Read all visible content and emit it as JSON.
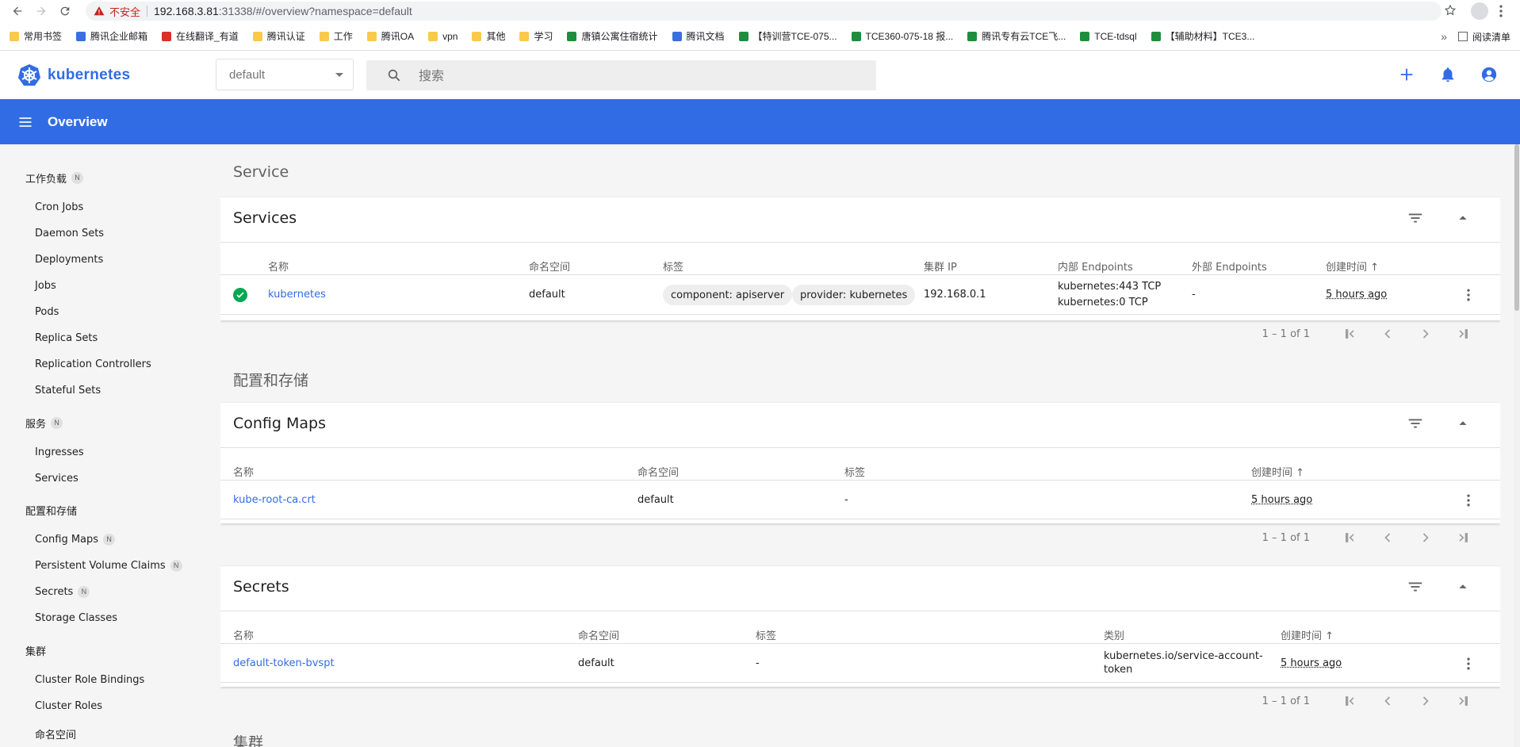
{
  "browser": {
    "insecure_label": "不安全",
    "url_host": "192.168.3.81",
    "url_rest": ":31338/#/overview?namespace=default",
    "bookmarks": [
      {
        "label": "常用书签",
        "kind": "folder"
      },
      {
        "label": "腾讯企业邮箱",
        "kind": "blue"
      },
      {
        "label": "在线翻译_有道",
        "kind": "red"
      },
      {
        "label": "腾讯认证",
        "kind": "folder"
      },
      {
        "label": "工作",
        "kind": "folder"
      },
      {
        "label": "腾讯OA",
        "kind": "folder"
      },
      {
        "label": "vpn",
        "kind": "folder"
      },
      {
        "label": "其他",
        "kind": "folder"
      },
      {
        "label": "学习",
        "kind": "folder"
      },
      {
        "label": "唐镇公寓住宿统计",
        "kind": "sheet"
      },
      {
        "label": "腾讯文档",
        "kind": "blue"
      },
      {
        "label": "【特训营TCE-075...",
        "kind": "sheet"
      },
      {
        "label": "TCE360-075-18 报...",
        "kind": "sheet"
      },
      {
        "label": "腾讯专有云TCE飞...",
        "kind": "sheet"
      },
      {
        "label": "TCE-tdsql",
        "kind": "sheet"
      },
      {
        "label": "【辅助材料】TCE3...",
        "kind": "sheet"
      }
    ],
    "overflow": "»",
    "reading_list": "阅读清单"
  },
  "header": {
    "logo_text": "kubernetes",
    "namespace": "default",
    "search_placeholder": "搜索"
  },
  "toolbar": {
    "title": "Overview"
  },
  "sidebar": {
    "workloads": {
      "label": "工作负载",
      "badge": "N",
      "items": [
        "Cron Jobs",
        "Daemon Sets",
        "Deployments",
        "Jobs",
        "Pods",
        "Replica Sets",
        "Replication Controllers",
        "Stateful Sets"
      ]
    },
    "services": {
      "label": "服务",
      "badge": "N",
      "items": [
        "Ingresses",
        "Services"
      ]
    },
    "config": {
      "label": "配置和存储",
      "items": [
        {
          "label": "Config Maps",
          "badge": "N"
        },
        {
          "label": "Persistent Volume Claims",
          "badge": "N"
        },
        {
          "label": "Secrets",
          "badge": "N"
        },
        {
          "label": "Storage Classes",
          "badge": ""
        }
      ]
    },
    "cluster": {
      "label": "集群",
      "items": [
        "Cluster Role Bindings",
        "Cluster Roles",
        "命名空间"
      ]
    }
  },
  "main": {
    "service_section": "Service",
    "services": {
      "title": "Services",
      "columns": [
        "名称",
        "命名空间",
        "标签",
        "集群 IP",
        "内部 Endpoints",
        "外部 Endpoints",
        "创建时间"
      ],
      "row": {
        "name": "kubernetes",
        "namespace": "default",
        "labels": [
          "component: apiserver",
          "provider: kubernetes"
        ],
        "cluster_ip": "192.168.0.1",
        "internal_endpoints": [
          "kubernetes:443 TCP",
          "kubernetes:0 TCP"
        ],
        "external_endpoints": "-",
        "created": "5 hours ago"
      },
      "range": "1 – 1 of 1"
    },
    "config_section": "配置和存储",
    "config_maps": {
      "title": "Config Maps",
      "columns": [
        "名称",
        "命名空间",
        "标签",
        "创建时间"
      ],
      "row": {
        "name": "kube-root-ca.crt",
        "namespace": "default",
        "labels": "-",
        "created": "5 hours ago"
      },
      "range": "1 – 1 of 1"
    },
    "secrets": {
      "title": "Secrets",
      "columns": [
        "名称",
        "命名空间",
        "标签",
        "类别",
        "创建时间"
      ],
      "row": {
        "name": "default-token-bvspt",
        "namespace": "default",
        "labels": "-",
        "type_line1": "kubernetes.io/service-account-",
        "type_line2": "token",
        "created": "5 hours ago"
      },
      "range": "1 – 1 of 1"
    },
    "cluster_section": "集群"
  },
  "colors": {
    "brand": "#326ce5",
    "toolbar": "#326ce5",
    "ok": "#00a854"
  }
}
